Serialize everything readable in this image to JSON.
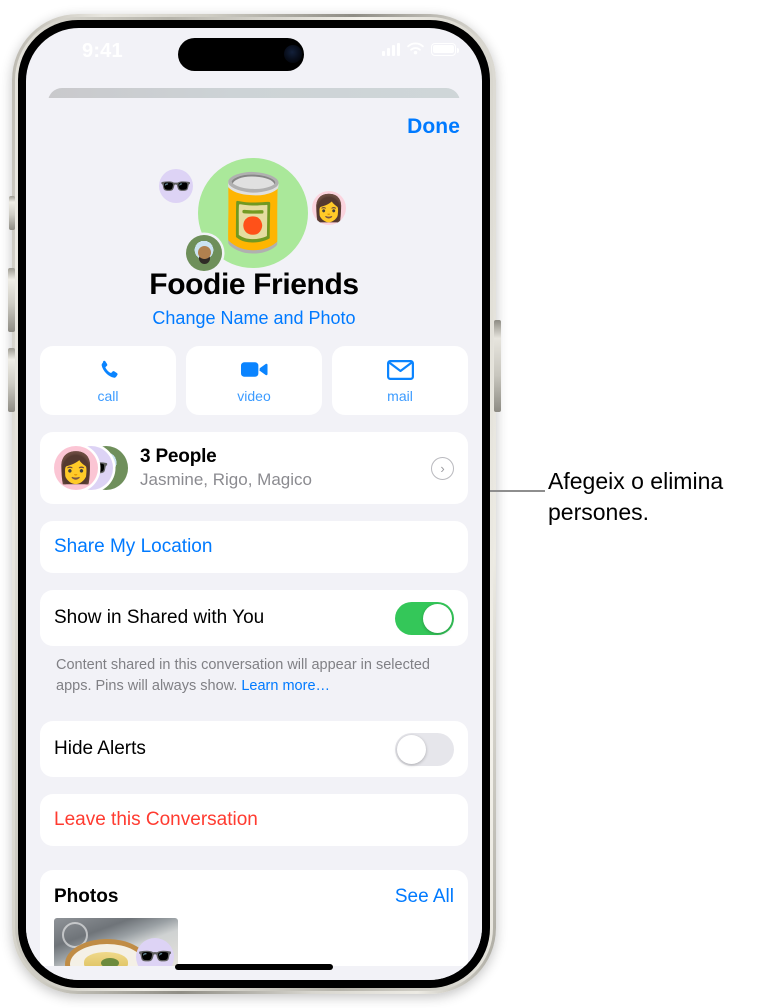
{
  "status_bar": {
    "time": "9:41",
    "icons": [
      "cellular-signal-icon",
      "wifi-icon",
      "battery-icon"
    ]
  },
  "sheet": {
    "done_label": "Done",
    "group": {
      "avatar_icon": "canned-tomato-emoji",
      "avatar_glyph": "🥫",
      "avatar_bg": "#AAE89A",
      "member_avatars": [
        "memoji-sunglasses",
        "memoji-glasses",
        "photo-avatar-outdoors"
      ],
      "name": "Foodie Friends",
      "change_link": "Change Name and Photo"
    },
    "actions": [
      {
        "name": "call",
        "label": "call",
        "icon": "phone-icon"
      },
      {
        "name": "video",
        "label": "video",
        "icon": "video-camera-icon"
      },
      {
        "name": "mail",
        "label": "mail",
        "icon": "envelope-icon"
      }
    ],
    "people": {
      "title": "3 People",
      "subtitle": "Jasmine, Rigo, Magico",
      "chevron_icon": "chevron-right-icon"
    },
    "share_location_label": "Share My Location",
    "shared_with_you": {
      "label": "Show in Shared with You",
      "toggle_state": "on",
      "footnote_text": "Content shared in this conversation will appear in selected apps. Pins will always show. ",
      "footnote_link": "Learn more…"
    },
    "hide_alerts": {
      "label": "Hide Alerts",
      "toggle_state": "off"
    },
    "leave_label": "Leave this Conversation",
    "photos": {
      "title": "Photos",
      "see_all_label": "See All",
      "thumbnail_icon": "food-photo-thumbnail",
      "thumbnail_avatar_icon": "memoji-sunglasses"
    }
  },
  "callout": {
    "text": "Afegeix o elimina persones.",
    "line_color": "#8E8E8E"
  },
  "colors": {
    "accent_blue": "#007AFF",
    "destructive_red": "#FF3B30",
    "toggle_green": "#34C759",
    "sheet_bg": "#F2F2F7",
    "card_bg": "#FFFFFF"
  }
}
